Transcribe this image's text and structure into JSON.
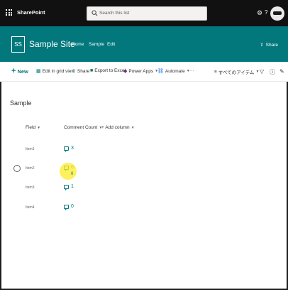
{
  "suitebar": {
    "app_name": "SharePoint",
    "search_placeholder": "Search this list",
    "settings_icon": "gear-icon",
    "help_label": "?"
  },
  "site": {
    "logo_initials": "SS",
    "title": "Sample Site",
    "nav": [
      "Home",
      "Sample",
      "Edit"
    ],
    "share_label": "Share"
  },
  "commandbar": {
    "new_label": "New",
    "edit_grid_label": "Edit in grid view",
    "share_label": "Share",
    "export_label": "Export to Excel",
    "powerapps_label": "Power Apps",
    "automate_label": "Automate",
    "more_label": "···",
    "view_label": "すべてのアイテム",
    "filter_icon": "filter-icon",
    "info_icon": "info-icon",
    "edit_icon": "pencil-icon"
  },
  "list": {
    "title": "Sample",
    "columns": {
      "field": "Field",
      "comment_count": "Comment Count",
      "add_column": "+ Add column"
    },
    "rows": [
      {
        "item": "Item1",
        "count": "3"
      },
      {
        "item": "Item2",
        "count": "0"
      },
      {
        "item": "Item3",
        "count": "1"
      },
      {
        "item": "Item4",
        "count": "0"
      }
    ],
    "cursor_sub_label": "0"
  },
  "colors": {
    "suitebar": "#111111",
    "theme": "#03787c",
    "highlight": "#ffec28"
  }
}
